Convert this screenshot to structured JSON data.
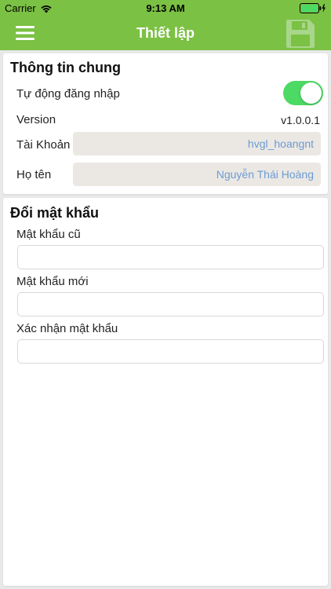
{
  "status_bar": {
    "carrier": "Carrier",
    "time": "9:13 AM"
  },
  "nav": {
    "title": "Thiết lập",
    "menu_icon": "hamburger-menu-icon",
    "save_icon": "floppy-disk-icon"
  },
  "general": {
    "title": "Thông tin chung",
    "auto_login_label": "Tự động đăng nhập",
    "auto_login_enabled": true,
    "version_label": "Version",
    "version_value": "v1.0.0.1",
    "account_label": "Tài Khoản",
    "account_value": "hvgl_hoangnt",
    "fullname_label": "Họ tên",
    "fullname_value": "Nguyễn Thái Hoàng"
  },
  "password": {
    "title": "Đổi mật khẩu",
    "old_label": "Mật khẩu cũ",
    "new_label": "Mật khẩu mới",
    "confirm_label": "Xác nhận mật khẩu"
  },
  "colors": {
    "brand_green": "#7bc144",
    "toggle_on": "#4cd964",
    "readonly_text": "#6c9bd2",
    "readonly_bg": "#ebe8e4"
  }
}
